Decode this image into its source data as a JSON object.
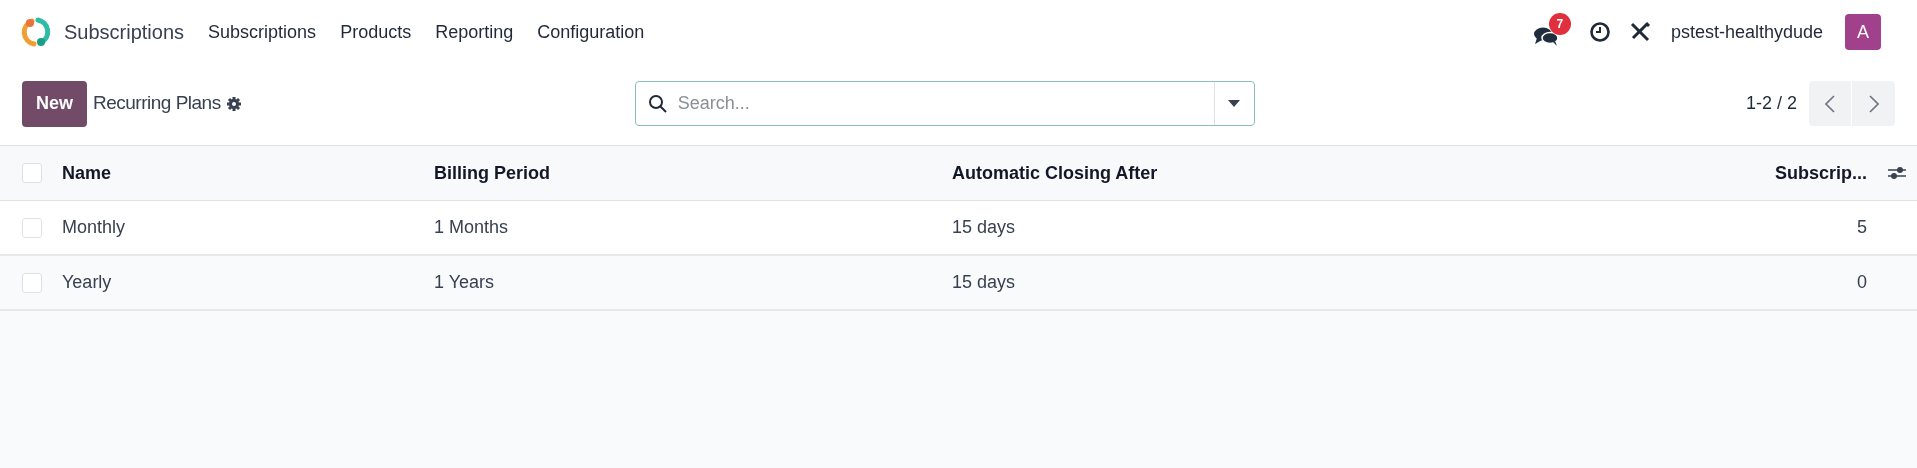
{
  "navbar": {
    "app_name": "Subscriptions",
    "menu": [
      "Subscriptions",
      "Products",
      "Reporting",
      "Configuration"
    ],
    "messages_count": "7",
    "company": "pstest-healthydude",
    "avatar_letter": "A"
  },
  "control_panel": {
    "new_button": "New",
    "breadcrumb": "Recurring Plans",
    "search": {
      "placeholder": "Search..."
    },
    "pager": "1-2 / 2"
  },
  "table": {
    "select_all": {
      "checked": false
    },
    "columns": [
      {
        "label": "Name"
      },
      {
        "label": "Billing Period"
      },
      {
        "label": "Automatic Closing After"
      },
      {
        "label": "Subscrip..."
      }
    ],
    "rows": [
      {
        "checked": false,
        "cells": [
          "Monthly",
          "1 Months",
          "15 days",
          "5"
        ]
      },
      {
        "checked": false,
        "cells": [
          "Yearly",
          "1 Years",
          "15 days",
          "0"
        ]
      }
    ]
  }
}
